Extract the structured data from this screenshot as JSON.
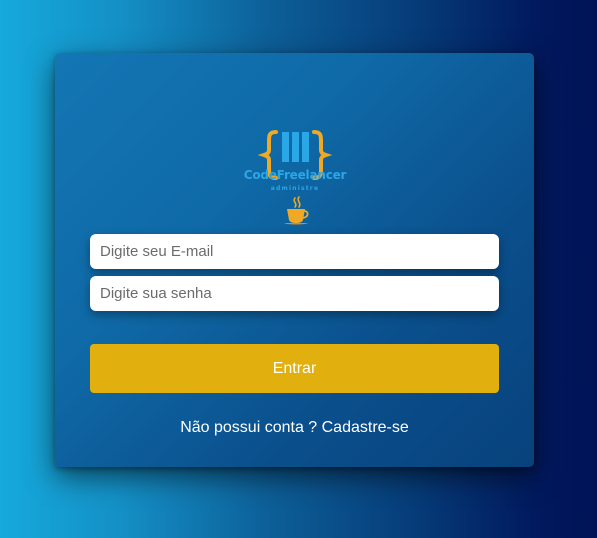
{
  "brand": {
    "name": "CodeFreelancer",
    "tagline": "administre",
    "logo_icon": "code-braces-icon",
    "cup_icon": "coffee-cup-icon"
  },
  "form": {
    "email_placeholder": "Digite seu E-mail",
    "email_value": "",
    "password_placeholder": "Digite sua senha",
    "password_value": "",
    "submit_label": "Entrar",
    "signup_link": "Não possui conta ? Cadastre-se"
  },
  "colors": {
    "accent_gold": "#e1b00e",
    "brand_blue": "#2aa7e6",
    "card_bg": "#0f6aa7"
  }
}
